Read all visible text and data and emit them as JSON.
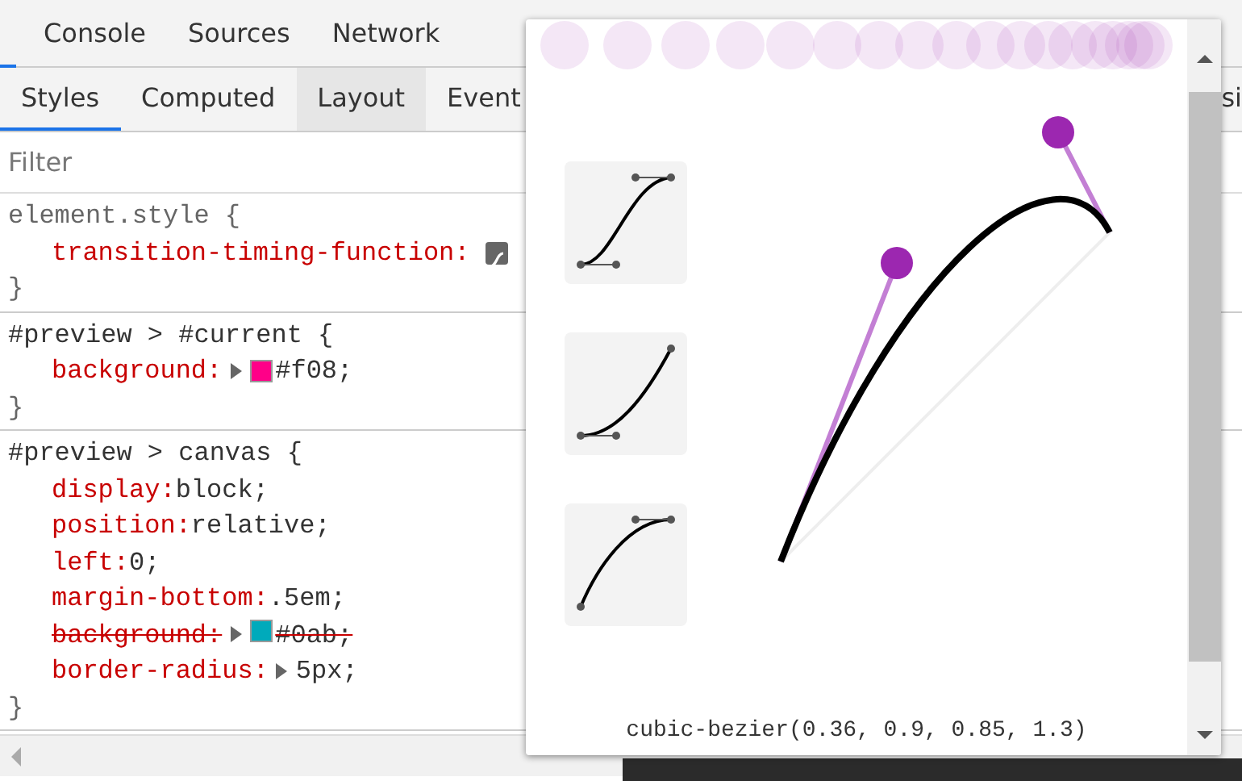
{
  "main_tabs": [
    {
      "label": "Console",
      "selected": false
    },
    {
      "label": "Sources",
      "selected": false
    },
    {
      "label": "Network",
      "selected": false
    }
  ],
  "sub_tabs": [
    {
      "label": "Styles",
      "selected": true,
      "hovered": false
    },
    {
      "label": "Computed",
      "selected": false,
      "hovered": false
    },
    {
      "label": "Layout",
      "selected": false,
      "hovered": true
    },
    {
      "label": "Event",
      "selected": false,
      "hovered": false
    },
    {
      "label": "si",
      "selected": false,
      "hovered": false
    }
  ],
  "filter": {
    "placeholder": "Filter"
  },
  "rules": [
    {
      "selector": "element.style {",
      "declarations": [
        {
          "property": "transition-timing-function:",
          "kind": "bezier",
          "struck": false
        }
      ],
      "close": "}"
    },
    {
      "selector": "#preview > #current {",
      "declarations": [
        {
          "property": "background:",
          "value": "#f08;",
          "kind": "color",
          "color": "#ff0088",
          "struck": false
        }
      ],
      "close": "}"
    },
    {
      "selector": "#preview > canvas {",
      "declarations": [
        {
          "property": "display:",
          "value": "block;",
          "kind": "plain",
          "struck": false
        },
        {
          "property": "position:",
          "value": "relative;",
          "kind": "plain",
          "struck": false
        },
        {
          "property": "left:",
          "value": "0;",
          "kind": "plain",
          "struck": false
        },
        {
          "property": "margin-bottom:",
          "value": ".5em;",
          "kind": "plain",
          "struck": false
        },
        {
          "property": "background:",
          "value": "#0ab;",
          "kind": "color",
          "color": "#00aabb",
          "struck": true
        },
        {
          "property": "border-radius:",
          "value": "5px;",
          "kind": "expandable",
          "struck": false
        }
      ],
      "close": "}"
    }
  ],
  "bezier_editor": {
    "curve_text": "cubic-bezier(0.36, 0.9, 0.85, 1.3)"
  }
}
